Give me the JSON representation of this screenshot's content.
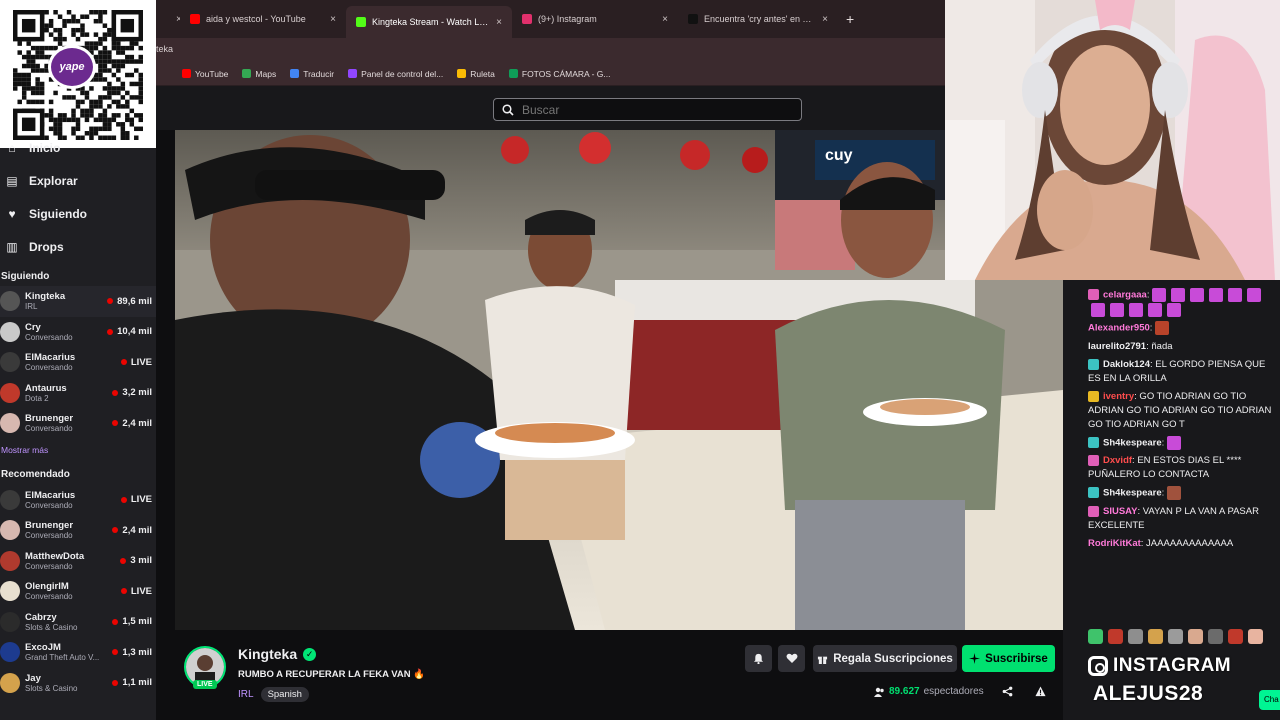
{
  "browser": {
    "tabs": [
      {
        "label": "",
        "close": "×",
        "icon": "unknown-tab-icon",
        "color": "#cccccc"
      },
      {
        "label": "aida y westcol - YouTube",
        "close": "×",
        "icon": "youtube-icon",
        "color": "#ff0000"
      },
      {
        "label": "Kingteka Stream - Watch Live o",
        "close": "×",
        "icon": "kick-icon",
        "color": "#53fc18"
      },
      {
        "label": "(9+) Instagram",
        "close": "×",
        "icon": "instagram-icon",
        "color": "#e1306c"
      },
      {
        "label": "Encuentra 'cry antes' en TikTok",
        "close": "×",
        "icon": "tiktok-icon",
        "color": "#111111"
      }
    ],
    "new_tab": "+",
    "address_fragment": "teka",
    "bookmarks": [
      {
        "label": "YouTube",
        "icon": "youtube-icon",
        "color": "#ff0000"
      },
      {
        "label": "Maps",
        "icon": "maps-icon",
        "color": "#34a853"
      },
      {
        "label": "Traducir",
        "icon": "translate-icon",
        "color": "#4285f4"
      },
      {
        "label": "Panel de control del...",
        "icon": "twitch-icon",
        "color": "#9146ff"
      },
      {
        "label": "Ruleta",
        "icon": "ruleta-icon",
        "color": "#fbbc05"
      },
      {
        "label": "FOTOS CÁMARA - G...",
        "icon": "drive-icon",
        "color": "#0f9d58"
      }
    ]
  },
  "topbar": {
    "search_placeholder": "Buscar"
  },
  "qr": {
    "brand": "yape"
  },
  "nav": {
    "items": [
      {
        "label": "Inicio",
        "icon": "home-icon"
      },
      {
        "label": "Explorar",
        "icon": "explore-icon"
      },
      {
        "label": "Siguiendo",
        "icon": "heart-icon"
      },
      {
        "label": "Drops",
        "icon": "drops-icon"
      }
    ],
    "following_title": "Siguiendo",
    "following": [
      {
        "name": "Kingteka",
        "category": "IRL",
        "viewers": "89,6 mil",
        "color": "#555555"
      },
      {
        "name": "Cry",
        "category": "Conversando",
        "viewers": "10,4 mil",
        "color": "#c9c9c9"
      },
      {
        "name": "ElMacarius",
        "category": "Conversando",
        "viewers": "LIVE",
        "color": "#3a3a3a"
      },
      {
        "name": "Antaurus",
        "category": "Dota 2",
        "viewers": "3,2 mil",
        "color": "#c0392b"
      },
      {
        "name": "Brunenger",
        "category": "Conversando",
        "viewers": "2,4 mil",
        "color": "#d7b8b0"
      }
    ],
    "show_more": "Mostrar más",
    "recommended_title": "Recomendado",
    "recommended": [
      {
        "name": "ElMacarius",
        "category": "Conversando",
        "viewers": "LIVE",
        "color": "#3a3a3a"
      },
      {
        "name": "Brunenger",
        "category": "Conversando",
        "viewers": "2,4 mil",
        "color": "#d7b8b0"
      },
      {
        "name": "MatthewDota",
        "category": "Conversando",
        "viewers": "3 mil",
        "color": "#b03a2e"
      },
      {
        "name": "OlengirlM",
        "category": "Conversando",
        "viewers": "LIVE",
        "color": "#e8e0d0"
      },
      {
        "name": "Cabrzy",
        "category": "Slots & Casino",
        "viewers": "1,5 mil",
        "color": "#2b2b2b"
      },
      {
        "name": "ExcoJM",
        "category": "Grand Theft Auto V...",
        "viewers": "1,3 mil",
        "color": "#1d3b8f"
      },
      {
        "name": "Jay",
        "category": "Slots & Casino",
        "viewers": "1,1 mil",
        "color": "#d4a24c"
      }
    ]
  },
  "chat": {
    "messages": [
      {
        "user": "celargaaa",
        "text": ":",
        "badge": "#e05fb8",
        "color": "#ff7ad9",
        "emotes": 11,
        "emote_color": "#c84bd8"
      },
      {
        "user": "Alexander950",
        "text": ":",
        "badge": "",
        "color": "#ff7ad9",
        "emotes": 1,
        "emote_color": "#b8432a"
      },
      {
        "user": "laurelito2791",
        "text": ": ñada",
        "badge": "",
        "color": "#efeff1",
        "emotes": 0,
        "emote_color": ""
      },
      {
        "user": "Daklok124",
        "text": ": EL GORDO PIENSA QUE ES EN LA ORILLA",
        "badge": "#3cc3c3",
        "color": "#efeff1",
        "emotes": 0,
        "emote_color": ""
      },
      {
        "user": "iventry",
        "text": ": GO TIO ADRIAN GO TIO ADRIAN GO TIO ADRIAN GO TIO ADRIAN GO TIO ADRIAN GO T",
        "badge": "#e8b923",
        "color": "#ff4d4d",
        "emotes": 0,
        "emote_color": ""
      },
      {
        "user": "Sh4kespeare",
        "text": ":",
        "badge": "#3cc3c3",
        "color": "#efeff1",
        "emotes": 1,
        "emote_color": "#c84bd8"
      },
      {
        "user": "Dxvidf",
        "text": ": EN ESTOS DIAS EL **** PUÑALERO LO CONTACTA",
        "badge": "#e05fb8",
        "color": "#ff4d4d",
        "emotes": 0,
        "emote_color": ""
      },
      {
        "user": "Sh4kespeare",
        "text": ":",
        "badge": "#3cc3c3",
        "color": "#efeff1",
        "emotes": 1,
        "emote_color": "#a0523d"
      },
      {
        "user": "SIUSAY",
        "text": ": VAYAN P LA VAN A PASAR EXCELENTE",
        "badge": "#e05fb8",
        "color": "#ff7ad9",
        "emotes": 0,
        "emote_color": ""
      },
      {
        "user": "RodriKitKat",
        "text": ": JAAAAAAAAAAAAA",
        "badge": "",
        "color": "#ff7ad9",
        "emotes": 0,
        "emote_color": ""
      }
    ],
    "instagram_label": "INSTAGRAM",
    "instagram_handle": "ALEJUS28",
    "chat_button": "Cha"
  },
  "stream": {
    "streamer": "Kingteka",
    "live": "LIVE",
    "title": "RUMBO A RECUPERAR LA FEKA VAN 🔥",
    "category": "IRL",
    "language": "Spanish",
    "gift_label": "Regala Suscripciones",
    "subscribe_label": "Suscribirse",
    "viewers": "89.627",
    "viewers_label": "espectadores"
  },
  "colors": {
    "accent": "#00e070",
    "purple": "#bf94ff",
    "bg": "#0e0e10"
  }
}
